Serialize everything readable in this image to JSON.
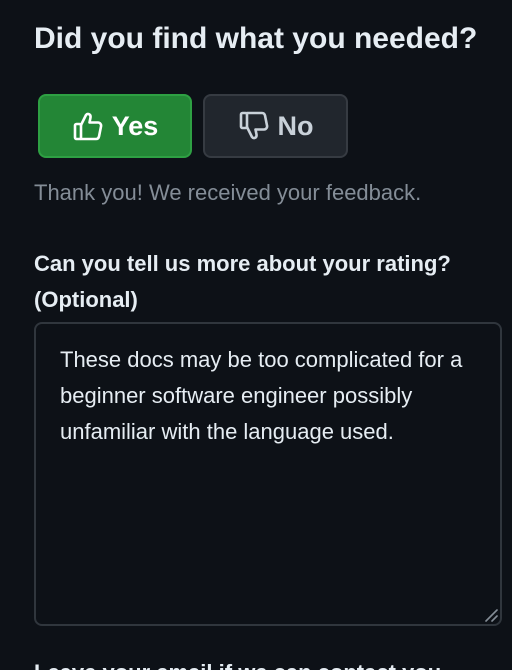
{
  "feedback": {
    "heading": "Did you find what you needed?",
    "yes_label": "Yes",
    "no_label": "No",
    "yes_icon": "thumbs-up-icon",
    "no_icon": "thumbs-down-icon",
    "confirmation": "Thank you! We received your feedback.",
    "question_line1": "Can you tell us more about your rating?",
    "question_line2": "(Optional)",
    "comment_value": "These docs may be too complicated for a beginner software engineer possibly unfamiliar with the language used.",
    "next_label": "Leave your email if we can contact you"
  },
  "colors": {
    "background": "#0d1117",
    "yes_button": "#238636",
    "no_button": "#21262d",
    "muted_text": "#848d97",
    "border": "#30363d"
  }
}
